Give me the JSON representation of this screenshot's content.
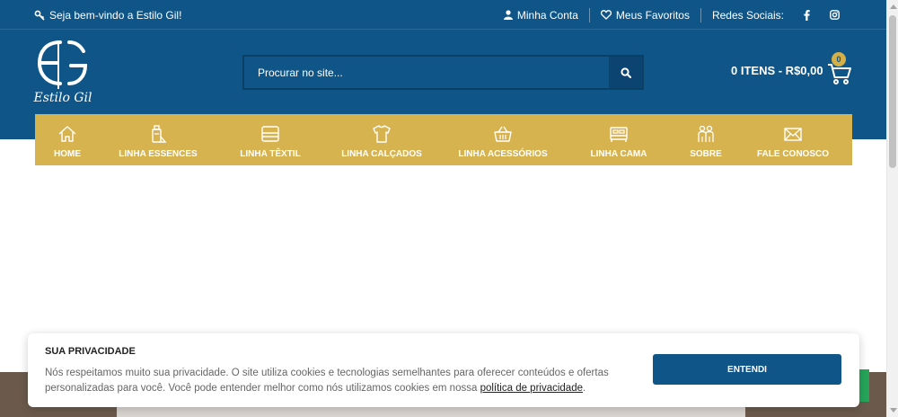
{
  "topbar": {
    "welcome": "Seja bem-vindo a Estilo Gil!",
    "account": "Minha Conta",
    "favorites": "Meus Favoritos",
    "social_label": "Redes Sociais:",
    "social_icons": [
      "facebook-icon",
      "instagram-icon"
    ]
  },
  "logo": {
    "text": "Estilo Gil"
  },
  "search": {
    "placeholder": "Procurar no site..."
  },
  "cart": {
    "summary": "0 ITENS - R$0,00",
    "count": "0"
  },
  "nav": [
    {
      "label": "HOME",
      "icon": "home-icon"
    },
    {
      "label": "LINHA ESSENCES",
      "icon": "perfume-icon"
    },
    {
      "label": "LINHA TÊXTIL",
      "icon": "towels-icon"
    },
    {
      "label": "LINHA CALÇADOS",
      "icon": "shirt-icon"
    },
    {
      "label": "LINHA ACESSÓRIOS",
      "icon": "basket-icon"
    },
    {
      "label": "LINHA CAMA",
      "icon": "bed-icon"
    },
    {
      "label": "SOBRE",
      "icon": "people-icon"
    },
    {
      "label": "FALE CONOSCO",
      "icon": "envelope-icon"
    }
  ],
  "cookie": {
    "title": "SUA PRIVACIDADE",
    "text": "Nós respeitamos muito sua privacidade. O site utiliza cookies e tecnologias semelhantes para oferecer conteúdos e ofertas personalizadas para você. Você pode entender melhor como nós utilizamos cookies em nossa ",
    "link": "política de privacidade",
    "text_end": ".",
    "button": "ENTENDI"
  },
  "colors": {
    "primary": "#0f5587",
    "accent": "#d7b350"
  }
}
